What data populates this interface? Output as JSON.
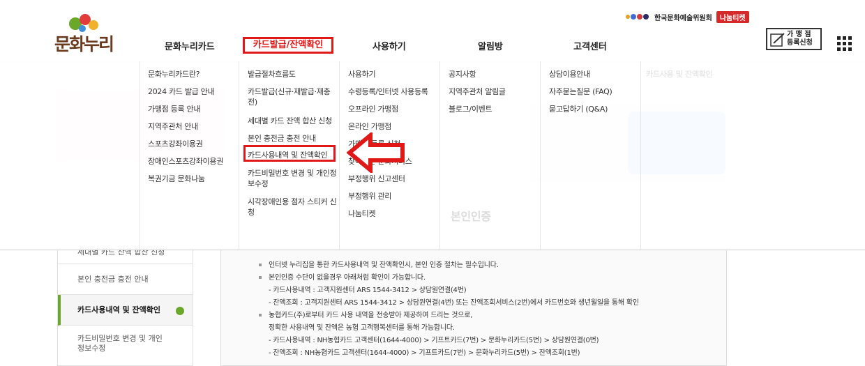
{
  "header": {
    "logo_text": "문화누리",
    "arko_label": "한국문화예술위원회",
    "arko_badge": "나눔티켓",
    "merchant_line1": "가 맹 점",
    "merchant_line2": "등록신청",
    "nav": [
      {
        "label": "문화누리카드"
      },
      {
        "label": "카드발급/잔액확인"
      },
      {
        "label": "사용하기"
      },
      {
        "label": "알림방"
      },
      {
        "label": "고객센터"
      }
    ]
  },
  "mega": {
    "col1": [
      "문화누리카드란?",
      "2024 카드 발급 안내",
      "가맹점 등록 안내",
      "지역주관처 안내",
      "스포츠강좌이용권",
      "장애인스포츠강좌이용권",
      "복권기금 문화나눔"
    ],
    "col2": [
      "발급절차흐름도",
      "카드발급(신규·재발급·재충전)",
      "세대별 카드 잔액 합산 신청",
      "본인 충전금 충전 안내",
      "카드사용내역 및 잔액확인",
      "카드비밀번호 변경 및 개인정보수정",
      "시각장애인용 점자 스티커 신청"
    ],
    "col3": [
      "사용하기",
      "수령등록/인터넷 사용등록",
      "오프라인 가맹점",
      "온라인 가맹점",
      "가맹점 등록 신청",
      "찾아가는 문화서비스",
      "부정행위 신고센터",
      "부정행위 관리",
      "나눔티켓"
    ],
    "col4": [
      "공지사항",
      "지역주관처 알림글",
      "블로그/이벤트"
    ],
    "col5": [
      "상담이용안내",
      "자주묻는질문 (FAQ)",
      "묻고답하기 (Q&A)"
    ],
    "banner_text": "카드사용 및 잔액확인",
    "bg_title": "본인인증"
  },
  "sidebar": {
    "items": [
      {
        "label": "세대별 카드 잔액 합산 신청"
      },
      {
        "label": "본인 충전금 충전 안내"
      },
      {
        "label": "카드사용내역 및 잔액확인"
      },
      {
        "label": "카드비밀번호 변경 및 개인"
      },
      {
        "label": "정보수정"
      }
    ]
  },
  "content": {
    "lines": [
      "인터넷 누리집을 통한 카드사용내역 및 잔액확인시, 본인 인증 절차는 필수입니다.",
      "본인인증 수단이 없을경우 아래처럼 확인이 가능합니다.",
      "- 카드사용내역 : 고객지원센터 ARS 1544-3412 > 상담원연결(4번)",
      "- 잔액조회 : 고객지원센터 ARS 1544-3412 > 상담원연결(4번) 또는 잔액조회서비스(2번)에서 카드번호와 생년월일을 통해 확인",
      "농협카드(주)로부터 카드 사용 내역을 전송받아 제공하여 드리는 것으로,",
      "정확한 사용내역 및 잔액은 농협 고객행복센터를 통해 가능합니다.",
      "- 카드사용내역 : NH농협카드 고객센터(1644-4000) > 기프트카드(7번) > 문화누리카드(5번) > 상담원연결(0번)",
      "- 잔액조회 : NH농협카드 고객센터(1644-4000) > 기프트카드(7번) > 문화누리카드(5번) > 잔액조회(1번)"
    ]
  },
  "colors": {
    "accent_red": "#e01818",
    "green": "#6aa82a",
    "brown": "#6a3b1e"
  }
}
